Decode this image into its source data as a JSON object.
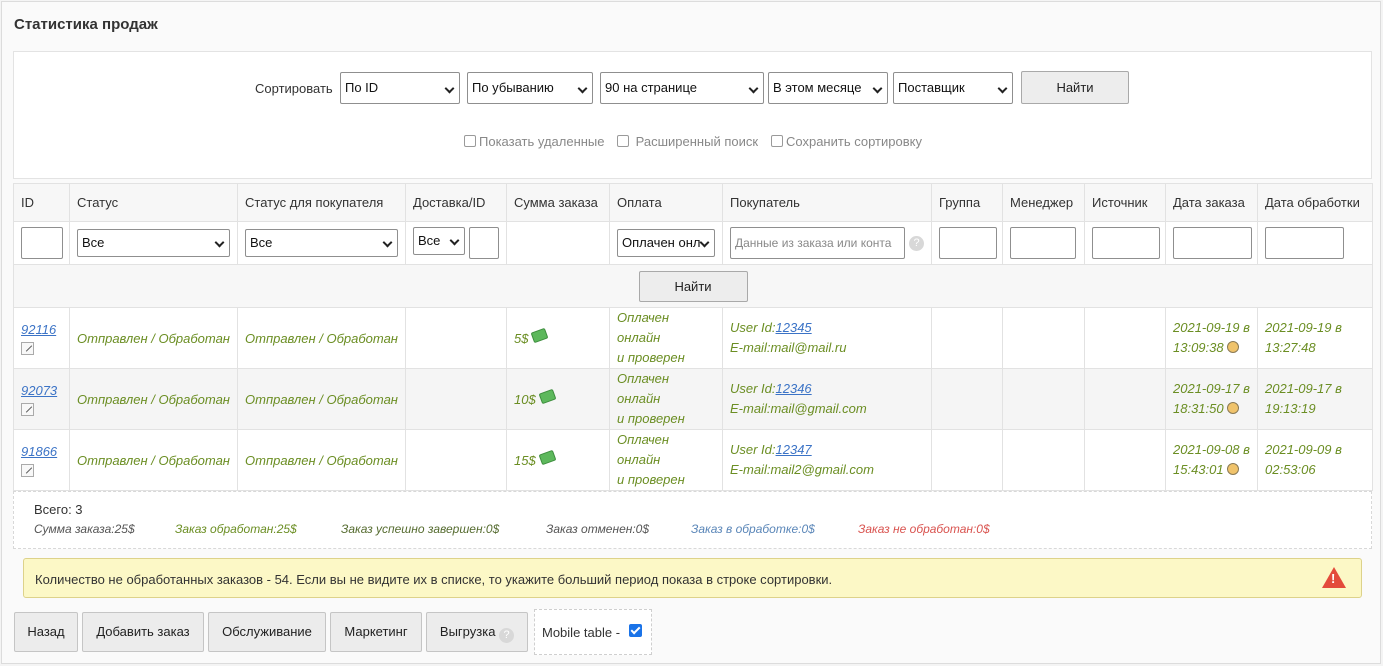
{
  "page": {
    "title": "Статистика продаж"
  },
  "sort": {
    "label": "Сортировать",
    "by": "По ID",
    "order": "По убыванию",
    "per_page": "90 на странице",
    "period": "В этом месяце",
    "supplier": "Поставщик",
    "find_label": "Найти",
    "checkboxes": [
      "Показать удаленные",
      "Расширенный поиск",
      "Сохранить сортировку"
    ]
  },
  "table": {
    "columns": [
      "ID",
      "Статус",
      "Статус для покупателя",
      "Доставка/ID",
      "Сумма заказа",
      "Оплата",
      "Покупатель",
      "Группа",
      "Менеджер",
      "Источник",
      "Дата заказа",
      "Дата обработки"
    ],
    "filters": {
      "status": "Все",
      "buyer_status": "Все",
      "delivery": "Все",
      "payment": "Оплачен онл",
      "buyer_placeholder": "Данные из заказа или конта"
    },
    "search_label": "Найти",
    "rows": [
      {
        "id": "92116",
        "status": "Отправлен / Обработан",
        "buyer_status": "Отправлен / Обработан",
        "sum": "5$",
        "payment_line1": "Оплачен онлайн",
        "payment_line2": "и проверен",
        "user_prefix": "User Id:",
        "user_id": "12345",
        "email": "E-mail:mail@mail.ru",
        "order_date_line1": "2021-09-19 в",
        "order_date_line2": "13:09:38",
        "processed_line1": "2021-09-19 в",
        "processed_line2": "13:27:48"
      },
      {
        "id": "92073",
        "status": "Отправлен / Обработан",
        "buyer_status": "Отправлен / Обработан",
        "sum": "10$",
        "payment_line1": "Оплачен онлайн",
        "payment_line2": "и проверен",
        "user_prefix": "User Id:",
        "user_id": "12346",
        "email": "E-mail:mail@gmail.com",
        "order_date_line1": "2021-09-17 в",
        "order_date_line2": "18:31:50",
        "processed_line1": "2021-09-17 в",
        "processed_line2": "19:13:19"
      },
      {
        "id": "91866",
        "status": "Отправлен / Обработан",
        "buyer_status": "Отправлен / Обработан",
        "sum": "15$",
        "payment_line1": "Оплачен онлайн",
        "payment_line2": "и проверен",
        "user_prefix": "User Id:",
        "user_id": "12347",
        "email": "E-mail:mail2@gmail.com",
        "order_date_line1": "2021-09-08 в",
        "order_date_line2": "15:43:01",
        "processed_line1": "2021-09-09 в",
        "processed_line2": "02:53:06"
      }
    ]
  },
  "totals": {
    "count": "Всего: 3",
    "sum": "Сумма заказа:25$",
    "processed": "Заказ обработан:25$",
    "completed": "Заказ успешно завершен:0$",
    "cancelled": "Заказ отменен:0$",
    "in_progress": "Заказ в обработке:0$",
    "not_processed": "Заказ не обработан:0$",
    "colors": {
      "processed": "#6b8e23",
      "completed": "#556b2f",
      "cancelled": "#555555",
      "in_progress": "#5a86b8",
      "not_processed": "#d9534f"
    }
  },
  "warning": {
    "text": "Количество не обработанных заказов - 54. Если вы не видите их в списке, то укажите больший период показа в строке сортировки."
  },
  "actions": {
    "back": "Назад",
    "add_order": "Добавить заказ",
    "service": "Обслуживание",
    "marketing": "Маркетинг",
    "export": "Выгрузка",
    "help_glyph": "?",
    "mobile_table": "Mobile table -"
  }
}
